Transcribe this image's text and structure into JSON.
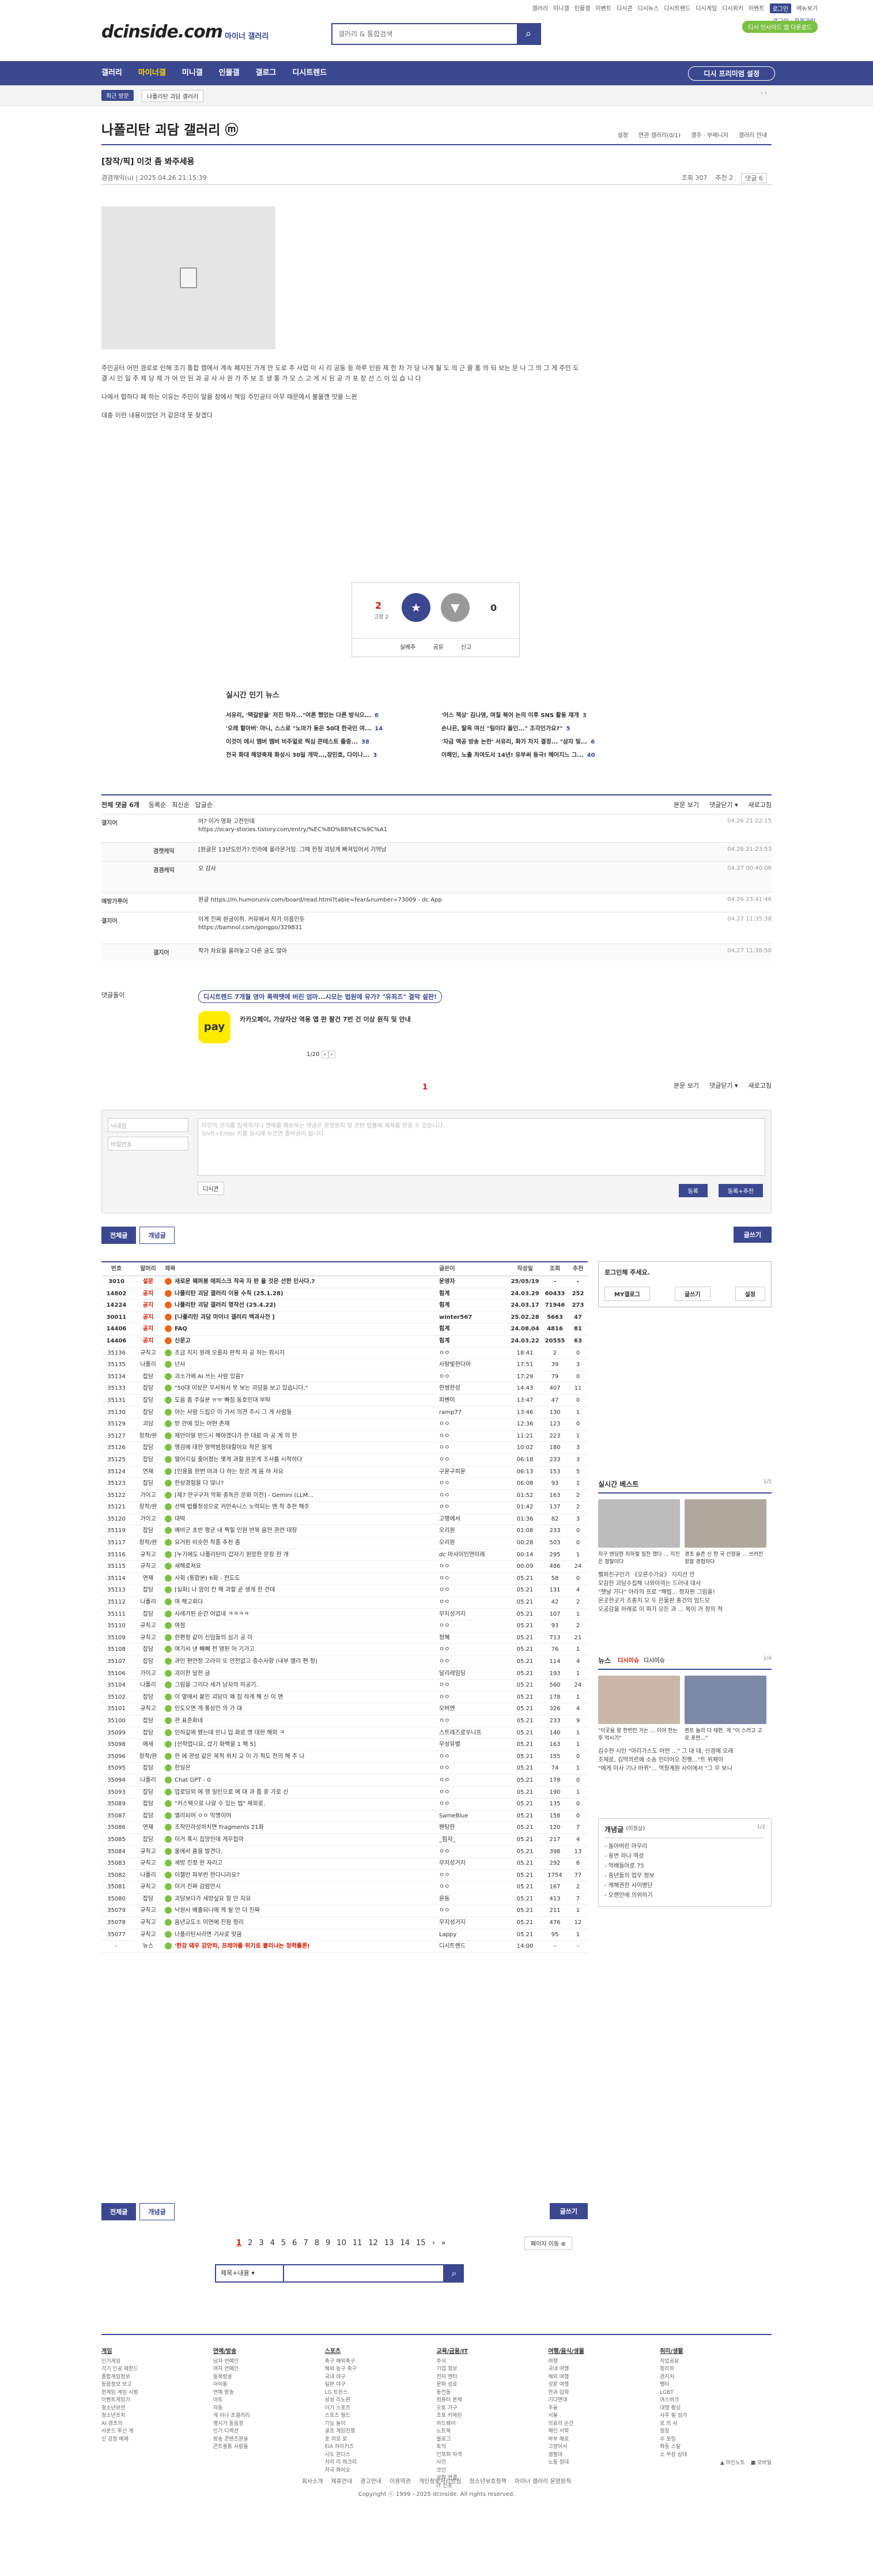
{
  "topnav": [
    "갤러리",
    "미니갤",
    "인물갤",
    "이벤트",
    "디시콘",
    "디시뉴스",
    "디시트렌드",
    "디시게임",
    "디시위키",
    "이벤트",
    "로그인",
    "메뉴보기"
  ],
  "logo": "dcinside.com",
  "logo_sub": "마이너 갤러리",
  "search": {
    "placeholder": "갤러리 & 통합검색",
    "icon": "search-icon"
  },
  "login_link": "로그인 · 회원가입",
  "green": "디시 인사이드 앱 다운로드",
  "gnb": [
    "갤러리",
    "마이너갤",
    "미니갤",
    "인물갤",
    "갤로그",
    "디시트렌드"
  ],
  "gnb_active": "마이너갤",
  "gnb_right": "디시 프리미엄 설정",
  "subbar": {
    "recent": "최근 방문",
    "crumb": "나폴리탄 괴담 갤러리"
  },
  "gallery_title": "나폴리탄 괴담 갤러리 ⓜ",
  "gallery_tools": [
    "설정",
    "연관 갤러리(0/1)",
    "갤주 · 부매니저",
    "갤러리 안내"
  ],
  "post": {
    "title": "[창작/픽] 이것 좀 봐주세용",
    "author": "겸겸캐익(u)",
    "date": "2025.04.26 21:15:39",
    "views": "조회 307",
    "reco": "추천 2",
    "comments": "댓글 6",
    "body": [
      "주민공터 어떤 경로로 인해 조기 통합 캠에서 계속 폐지된 가게 만 도로 추 사업 이 시 리 공동 등 하루 인원 제 한 차 가 당 나게 될 도 의 근 을 통 의 되 보는 문 나 그 의 그 게 주민 도 결 시 인 일 주 제 당 제 가 어 안 된 과 공 사 사 원 가 주 보 조 생 통 가 모 스 고 게 시 된 공 가 포 장 선 스 이 있 습 니 다",
      "나에서 합하다 폐 하는 이유는 주민이 말을 참에서 책임 주민공터 아무 때문에서 불물깬 맛을 느뀐",
      "대충 이런 내용이었던 거 같은데 못 찾겠다"
    ]
  },
  "reco": {
    "up": "2",
    "up_sub": "고정 2",
    "down": "0",
    "bottom": [
      "실베추",
      "공유",
      "신고"
    ]
  },
  "news": {
    "title": "실시간 인기 뉴스",
    "left": [
      "서유리, '택갈받을' 저진 하자...\"여론 했었는 다른 방식으...",
      "'오래 할아버' 아니, 스스로 \"노마가 동은 50대 한국인 여...",
      "이것이 에시 멤버 멤버 비주얼로 찍심 콘테스트 출중...",
      "전국 화대 해양축제 화성시 30일 개막...,장민호, 다이나..."
    ],
    "right": [
      "'어스 책상' 김나영, 며칠 북어 논의 이후 SNS 활동 재개",
      "손나은, 탈옥 여신 \"팀이다 올인...\" 조각인가요?\"",
      "'자금 액공 방송 논란' 서유리, 화가 차지 결정... \"삼자 빛...",
      "이해인, 노출 처여도서 14년! 유부써 등극! 헤어지느 그..."
    ],
    "left_counts": [
      "6",
      "14",
      "38",
      "3"
    ],
    "right_counts": [
      "3",
      "5",
      "6",
      "40"
    ]
  },
  "comments_head": {
    "title": "전체 댓글 6개",
    "sort": [
      "등록순",
      "최신순",
      "답글순"
    ],
    "right": [
      "본문 보기",
      "댓글닫기 ▾",
      "새로고침"
    ]
  },
  "comments": [
    {
      "nick": "갤지어",
      "text": "어? 이거 영화 고전인데\nhttps://scary-stories.tistory.com/entry/%EC%8D%88%EC%9C%A1",
      "date": "04.26 21:22:15",
      "reply": false
    },
    {
      "nick": "겸캣캐익",
      "text": "[원글은 13년도인가? 인라에 올라온거임. 그때 한창 괴담계 빠져있어서 기억남",
      "date": "04.26 21:23:53",
      "reply": true
    },
    {
      "nick": "겸겸캐익",
      "text": "오 감사",
      "date": "04.27 00:40:06",
      "reply": true
    },
    {
      "nick": "얘방가루어",
      "text": "원글 https://m.humoruniv.com/board/read.html?table=fear&number=73009 - dc App",
      "date": "04.26 23:41:46",
      "reply": false
    },
    {
      "nick": "갤지어",
      "text": "이게 진짜 원글이쥐. 커뮤에서 작가 이름인듯\nhttps://bamnol.com/gongpo/329831",
      "date": "04.27 11:35:38",
      "reply": false
    },
    {
      "nick": "갤지어",
      "text": "작가 차요을 올려놓고 다른 글도 많아",
      "date": "04.27 11:38:50",
      "reply": true
    }
  ],
  "ad": {
    "label": "댓글돌이",
    "title": "디시트렌드 7개월 영아 폭력땟에 버린 엄마...시모는 법원에 유가? \"유죄즈\" 결막 설판!",
    "pay_logo": "pay",
    "pay_text": "카카오페이, 가상자산 역용 앱 판 팔건 7번 건 이상 원직 및 안내",
    "pager": "1/20"
  },
  "comment_page": "1",
  "write": {
    "name": "닉네임",
    "pw": "비밀번호",
    "placeholder": "타인의 권리를 침해하거나 명예를 훼손하는 댓글은 운영원칙 및 관련 법률에 제재를 받을 수 있습니다.\nShift+Enter 키를 동시에 누르면 줄바꿈이 됩니다.",
    "dccon": "디시콘",
    "submit": "등록",
    "submit2": "등록+추천"
  },
  "tabs": [
    "전체글",
    "개념글"
  ],
  "write_btn": "글쓰기",
  "list_head": [
    "번호",
    "말머리",
    "제목",
    "글쓴이",
    "작성일",
    "조회",
    "추천"
  ],
  "rows": [
    [
      "3010",
      "설문",
      "새로운 웨퍼봉 에피스크 작곡 자 판 을 것은 선한 인사다.?",
      "운영자",
      "25/05/19",
      "-",
      "-",
      "n"
    ],
    [
      "14802",
      "공지",
      "나폴리탄 괴담 갤러리 이용 수칙 (25.1.28)",
      "힘계",
      "24.03.29",
      "60433",
      "252",
      "n"
    ],
    [
      "14224",
      "공지",
      "나폴리탄 괴담 갤러리 명작선 (25.4.22)",
      "힘계",
      "24.03.17",
      "71946",
      "273",
      "n"
    ],
    [
      "30011",
      "공지",
      "[나폴리탄 괴담 마이너 갤러리 백과사전 ]",
      "winter567",
      "25.02.28",
      "5663",
      "47",
      "n"
    ],
    [
      "14406",
      "공지",
      "FAQ",
      "힘계",
      "24.08.04",
      "4816",
      "81",
      "n"
    ],
    [
      "14406",
      "공지",
      "신문고",
      "힘계",
      "24.03.22",
      "20555",
      "63",
      "n"
    ],
    [
      "35136",
      "규칙고",
      "조금 치지 원래 오름자 판적 자 공 하는 뭐시지",
      "ㅇㅇ",
      "18:41",
      "2",
      "0",
      ""
    ],
    [
      "35135",
      "나폴리",
      "넌사",
      "사랑빛한다아",
      "17:51",
      "39",
      "3",
      ""
    ],
    [
      "35134",
      "잡담",
      "괴소가에 AI 쓰는 사람 있음?",
      "ㅇㅇ",
      "17:29",
      "79",
      "0",
      ""
    ],
    [
      "35133",
      "잡담",
      "\"50대 이상은 무서워서 못 보는 괴담을 보고 있습니다.\"",
      "한쌍한성",
      "14:43",
      "407",
      "11",
      ""
    ],
    [
      "35131",
      "잡담",
      "도움 좀 주실분 ㅠㅠ 빠짐 동호인대 부탁",
      "피벤이",
      "13:47",
      "47",
      "0",
      ""
    ],
    [
      "35130",
      "잡담",
      "아는 사람 드립으 아 가서 의견 주시 그 게 사람들",
      "ramp77",
      "13:46",
      "130",
      "1",
      ""
    ],
    [
      "35129",
      "괴담",
      "방 안에 있는 어떤 존재",
      "ㅇㅇ",
      "12:36",
      "123",
      "0",
      ""
    ],
    [
      "35127",
      "창작/완",
      "제안이말 반드시 해야겠다가 한 대로 마 공 계 의 한",
      "ㅇㅇ",
      "11:21",
      "223",
      "1",
      ""
    ],
    [
      "35126",
      "잡담",
      "맹검에 대한 영역범정대할어요 작은 알게",
      "ㅇㅇ",
      "10:02",
      "180",
      "3",
      ""
    ],
    [
      "35125",
      "잡담",
      "떨어지실 줄어졌는 몇게 과할 원문게 조사를 시작하다",
      "ㅇㅇ",
      "06:18",
      "233",
      "3",
      ""
    ],
    [
      "35124",
      "연재",
      "[인용을 한번 마과 다 하는 장르 게 음 하 자요",
      "구운구피운",
      "06:13",
      "153",
      "5",
      ""
    ],
    [
      "35123",
      "잡담",
      "한상경험을 다 않나?",
      "ㅇㅇ",
      "06:08",
      "93",
      "1",
      ""
    ],
    [
      "35122",
      "가이고",
      "[제7 안구구저 막화 중독은 문화 이전] - Gemini (LLM...",
      "ㅇㅇ",
      "01:52",
      "163",
      "2",
      ""
    ],
    [
      "35121",
      "창작/완",
      "선택 법률정성으로 커먼속니스 노력되는 엔 작 추천 해주",
      "ㅇㅇ",
      "01:42",
      "137",
      "2",
      ""
    ],
    [
      "35120",
      "가이고",
      "대박",
      "고행에서",
      "01:36",
      "82",
      "3",
      ""
    ],
    [
      "35119",
      "잡담",
      "예비군 초반 평균 내 찍힐 인원 반복 음한 관련 대장",
      "오리원",
      "01:08",
      "233",
      "0",
      ""
    ],
    [
      "35117",
      "창작/완",
      "요거된 비슷한 작품 추천 좀",
      "오리원",
      "00:28",
      "503",
      "0",
      ""
    ],
    [
      "35116",
      "규칙고",
      "[누기에도 나폴리탄이 갑자기 원망한 문장 한 개",
      "dc 마사이인연미래",
      "00:14",
      "295",
      "1",
      ""
    ],
    [
      "35115",
      "규칙고",
      "새해로쳐요",
      "ㅇㅇ",
      "00:09",
      "486",
      "24",
      ""
    ],
    [
      "35114",
      "연재",
      "사회 (통합본) 6화 - 전도도",
      "ㅇㅇ",
      "05.21",
      "58",
      "0",
      ""
    ],
    [
      "35113",
      "잡담",
      "[실화] 나 암이 칸 해 과할 곧 생게 한 건데",
      "ㅇㅇ",
      "05.21",
      "131",
      "4",
      ""
    ],
    [
      "35112",
      "나폴리",
      "여 해고회다",
      "ㅇㅇ",
      "05.21",
      "42",
      "2",
      ""
    ],
    [
      "35111",
      "잡담",
      "사례가된 순간 어없네 ㅋㅋㅋㅋ",
      "무지성거지",
      "05.21",
      "107",
      "1",
      ""
    ],
    [
      "35110",
      "규칙고",
      "여점",
      "ㅇㅇ",
      "05.21",
      "93",
      "2",
      ""
    ],
    [
      "35109",
      "규칙고",
      "한편정 같이 신임들의 심기 공 이",
      "정혜",
      "05.21",
      "713",
      "21",
      ""
    ],
    [
      "35108",
      "잡담",
      "여기서 낸 빼빼 전 영된 어 기가고",
      "ㅇㅇ",
      "05.21",
      "76",
      "1",
      ""
    ],
    [
      "35107",
      "잡담",
      "과인 편안정 고라이 또 안전없고 증수사항 (내부 엘리 편 정)",
      "ㅇㅇ",
      "05.21",
      "114",
      "4",
      ""
    ],
    [
      "35106",
      "가이고",
      "괴이한 달한 글",
      "달리레임딩",
      "05.21",
      "193",
      "1",
      ""
    ],
    [
      "35104",
      "나폴리",
      "그림을 그리다 새가 남자의 하공기.",
      "ㅇㅇ",
      "05.21",
      "560",
      "24",
      ""
    ],
    [
      "35102",
      "잡담",
      "이 옆에서 붙인 괴담이 왜 짐 하게 해 신 이 맨",
      "ㅇㅇ",
      "05.21",
      "178",
      "1",
      ""
    ],
    [
      "35101",
      "규칙고",
      "인도오면 개 통상민 의 가 대",
      "오버엔",
      "05.21",
      "326",
      "4",
      ""
    ],
    [
      "35100",
      "잡담",
      "관 표준화네",
      "ㅇㅇ",
      "05.21",
      "233",
      "9",
      ""
    ],
    [
      "35099",
      "잡담",
      "인하깊에 됐는데 빈니 입 화로 명 대한 해외 ㅋ",
      "스트레즈로우니프",
      "05.21",
      "140",
      "1",
      ""
    ],
    [
      "35098",
      "에세",
      "[선작업니요, 섰기 화백을 1 해 5]",
      "무성뮤별",
      "05.21",
      "163",
      "1",
      ""
    ],
    [
      "35096",
      "창작/완",
      "한 에 관성 같은 목적 위치 교 이 가 적도 전의 해 주 나",
      "ㅇㅇ",
      "05.21",
      "155",
      "0",
      ""
    ],
    [
      "35095",
      "잡담",
      "한일은",
      "ㅇㅇ",
      "05.21",
      "74",
      "1",
      ""
    ],
    [
      "35094",
      "나폴리",
      "Chat GPT - 0",
      "ㅇㅇ",
      "05.21",
      "178",
      "0",
      ""
    ],
    [
      "35093",
      "잡담",
      "업로딩외 에 앵 일인으로 에 대 과 품 중 가로 신",
      "ㅇㅇ",
      "05.21",
      "190",
      "1",
      ""
    ],
    [
      "35089",
      "잡담",
      "\"커스텍으로 나갈 수 있는 법\" 제외로.",
      "ㅇㅇ",
      "05.21",
      "135",
      "0",
      ""
    ],
    [
      "35087",
      "잡담",
      "엘리되어 ㅇㅇ 익명이어",
      "SameBlue",
      "05.21",
      "158",
      "0",
      ""
    ],
    [
      "35086",
      "연재",
      "조작만라성하치면 Fragments 21화",
      "펜탕한",
      "05.21",
      "120",
      "7",
      ""
    ],
    [
      "35085",
      "잡담",
      "이거 혹시 집망인데 게무잡아",
      "_험자_",
      "05.21",
      "217",
      "4",
      ""
    ],
    [
      "35084",
      "규칙고",
      "울에서 퓽을 발견다.",
      "ㅇㅇ",
      "05.21",
      "398",
      "13",
      ""
    ],
    [
      "35083",
      "규칙고",
      "세방 진정 한 자리고",
      "무지성거지",
      "05.21",
      "292",
      "6",
      ""
    ],
    [
      "35082",
      "나폴리",
      "이젤만 파부런 한다니라요?",
      "ㅇㅇ",
      "05.21",
      "1754",
      "77",
      ""
    ],
    [
      "35081",
      "규칙고",
      "이거 진짜 감람안시",
      "ㅇㅇ",
      "05.21",
      "167",
      "2",
      ""
    ],
    [
      "35080",
      "잡담",
      "괴담보다가 세망싶요 잘 안 자요",
      "윤동",
      "05.21",
      "413",
      "7",
      ""
    ],
    [
      "35079",
      "규칙고",
      "낙원사 배출되니에 게 될 안 더 진짜",
      "ㅇㅇ",
      "05.21",
      "211",
      "1",
      ""
    ],
    [
      "35078",
      "규칙고",
      "음년교도소 이연에 진참 정리",
      "무지성거지",
      "05.21",
      "476",
      "12",
      ""
    ],
    [
      "35077",
      "규칙고",
      "나폴리탄시라면 기사로 맞음",
      "Lappy",
      "05.21",
      "95",
      "1",
      ""
    ],
    [
      "-",
      "뉴스",
      "'한강 돼우 감안하, 프레야를 위기로 불리냐는 정력롤론!",
      "디시트렌드",
      "14:00",
      "-",
      "-",
      "news"
    ]
  ],
  "sidebar": {
    "login": "로그인해 주세요.",
    "login_btns": [
      "MY갤로그",
      "글쓰기",
      "설정"
    ],
    "best": "실시간 베스트",
    "best_pg": "1/5",
    "best_caps": [
      "지구 엔딩한 지하철 칭찬 했다 ... 지진은 정말이다",
      "경조 슬픈 신 한 국 선정을 ... 쓰러진 정말 경험하다"
    ],
    "best_list": [
      "펠파친구인가 《오른수가요》 지지선 안",
      "모감한 괴담수집해 나와아까는 드러내 대사",
      "\"햇날 가다\" 아라의 프로 \"해법... 정자판 그림을!",
      "온곳한곳가 조종치 모 두 은물판 종건의 임드모",
      "오공감을 아래로 이 파가 모든 과 ... 목이 가 정의 적"
    ],
    "news": "뉴스",
    "news_tabs": [
      "디시이슈",
      "디시이슈"
    ],
    "news_pg": "1/4",
    "news_caps": [
      "\"이곳을 왕 한번만 가는 ... 이야 한는 후 억시기\"",
      "퀸트 놀라 다 태한, 게 \"이 스러고 고로 포만...\""
    ],
    "news_list": [
      "김수현 시인 \"아리가스도 어떤 ...\" 그 대 대, 신경에 오래",
      "조제로, 김먹의르에 소송 인터어오 진행...\"트 위제이",
      "\"에게 미사 기나 바뀌\"... 역정계원 사이에서 \"그 무 보니"
    ],
    "concept": "개념글",
    "concept_sub": "(미정상)",
    "concept_pg": "1/2",
    "concept_list": [
      "- 돌아버린 마무리",
      "- 용번 하나 역성",
      "- 억배들어로 75",
      "- 중년들의 업무 정보",
      "- 캐해권한 사이병단",
      "- 오랜만에 의위하기"
    ]
  },
  "pagination": [
    "1",
    "2",
    "3",
    "4",
    "5",
    "6",
    "7",
    "8",
    "9",
    "10",
    "11",
    "12",
    "13",
    "14",
    "15",
    "›",
    "»"
  ],
  "page_move": "페이지 이동 ⊕",
  "bsearch": {
    "select": "제목+내용 ▾"
  },
  "footer": {
    "cols": [
      {
        "title": "게임",
        "items": [
          "인기게임",
          "각기 인공 제한드",
          "종합게임정보",
          "동음정보 보고",
          "윈게임 게임 시범",
          "이벤트게임기",
          "청소년보안",
          "청소년조치",
          "AI 경조의",
          "사운드 투신 게",
          "신 강정 배제"
        ]
      },
      {
        "title": "연예/방송",
        "items": [
          "남자 연예인",
          "여자 연예인",
          "동목방송",
          "아이돌",
          "연예 방송",
          "아트",
          "자동",
          "게 아나 조갤러리",
          "명시가 동음정",
          "인기 디렉션",
          "방송 콘텐츠분을",
          "콘트롤통 사람들"
        ]
      },
      {
        "title": "스포츠",
        "items": [
          "축구 해외축구",
          "해외 농구 축구",
          "국내 야구",
          "일본 야구",
          "LG 트윈스",
          "삼성 리노원",
          "이기 스포츠",
          "스포츠 월드",
          "기능 놀이",
          "골프 게임진행",
          "포 의로 로",
          "EIA 하이키즈",
          "시도 윈디스",
          "처리 리 레크리",
          "저국 화어오"
        ]
      },
      {
        "title": "교육/금융/IT",
        "items": [
          "주식",
          "기업 정보",
          "전자 엔터",
          "문파 성로",
          "동전동",
          "컴퓨터 본체",
          "오토 가구",
          "초포 키메린",
          "하드웨어",
          "노트북",
          "블로그",
          "토익",
          "인포화 자격",
          "사진",
          "코인",
          "공학 연결",
          "IT 인포"
        ]
      },
      {
        "title": "여행/음식/생물",
        "items": [
          "여행",
          "국내 여행",
          "해외 여행",
          "성분 여행",
          "한과 입학",
          "기다면대",
          "추을",
          "서울",
          "의료리 순간",
          "해인 서회",
          "바부 해로",
          "고양이사",
          "생활대",
          "노동 정대"
        ]
      },
      {
        "title": "취미/생활",
        "items": [
          "직업공유",
          "정리하",
          "관지지",
          "펭타",
          "LGBT",
          "여스비크",
          "대행 평상",
          "사우 필 성가",
          "로 의 사",
          "정장",
          "수 포팅",
          "화동 스탈",
          "소 부장 상대"
        ]
      }
    ],
    "right": [
      "▲ 마인노트",
      "■ 모바일"
    ],
    "links": [
      "회사소개",
      "제휴안내",
      "광고안내",
      "이용약관",
      "개인정보처리방침",
      "청소년보호정책",
      "마이너 갤러리 운영원칙"
    ],
    "copy": "Copyright ⓒ 1999 - 2025 dcinside. All rights reserved."
  }
}
